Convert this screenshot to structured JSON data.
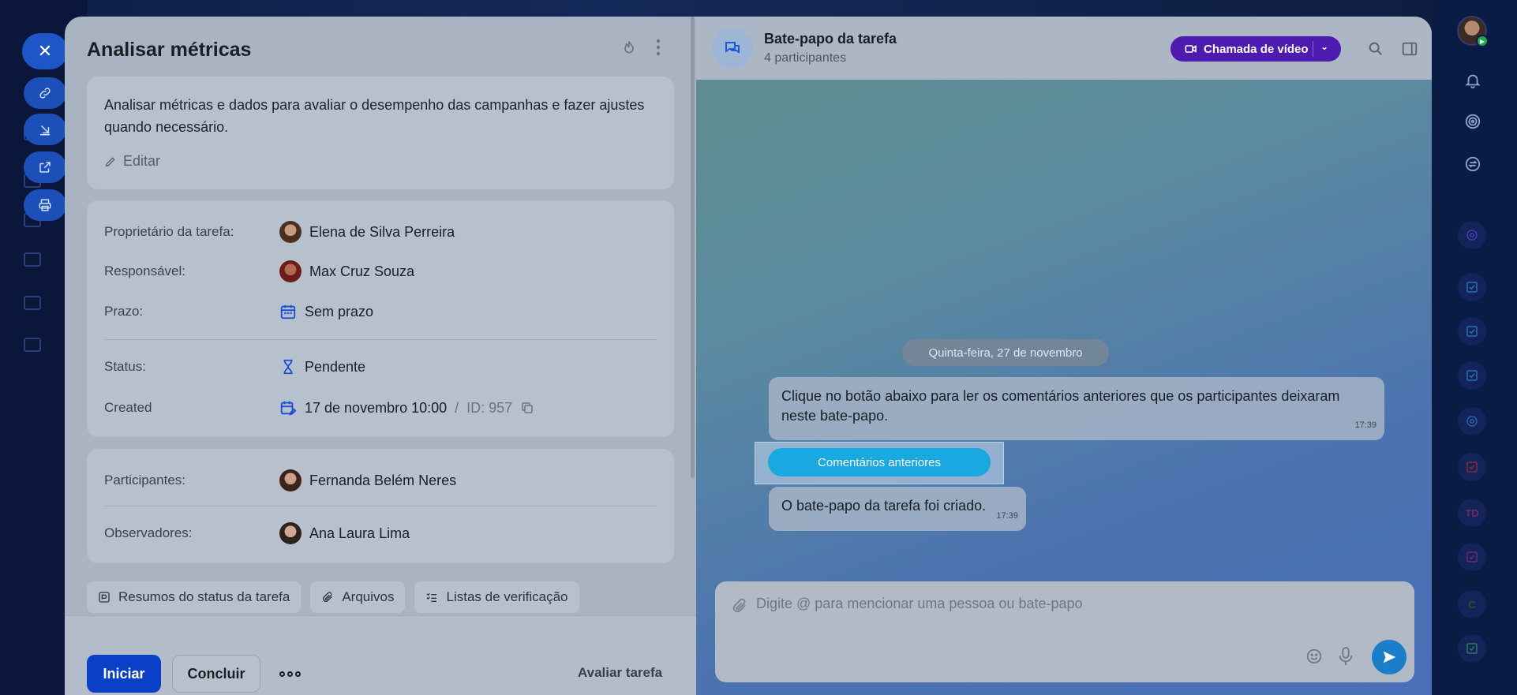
{
  "task": {
    "title": "Analisar métricas",
    "description": "Analisar métricas e dados para avaliar o desempenho das campanhas e fazer ajustes quando necessário.",
    "edit_label": "Editar",
    "owner_label": "Proprietário da tarefa:",
    "owner_value": "Elena de Silva Perreira",
    "assignee_label": "Responsável:",
    "assignee_value": "Max Cruz Souza",
    "deadline_label": "Prazo:",
    "deadline_value": "Sem prazo",
    "status_label": "Status:",
    "status_value": "Pendente",
    "created_label": "Created",
    "created_value": "17 de novembro 10:00",
    "id_sep": "/",
    "id_value": "ID: 957",
    "participants_label": "Participantes:",
    "participants_value": "Fernanda Belém Neres",
    "observers_label": "Observadores:",
    "observers_value": "Ana Laura Lima",
    "tabs": [
      "Resumos do status da tarefa",
      "Arquivos",
      "Listas de verificação"
    ],
    "start_label": "Iniciar",
    "complete_label": "Concluir",
    "rate_label": "Avaliar tarefa"
  },
  "chat": {
    "title": "Bate-papo da tarefa",
    "subtitle": "4 participantes",
    "video_label": "Chamada de vídeo",
    "date_label": "Quinta-feira, 27 de novembro",
    "message1": "Clique no botão abaixo para ler os comentários anteriores que os participantes deixaram neste bate-papo.",
    "message1_time": "17:39",
    "prev_comments_label": "Comentários anteriores",
    "message2": "O bate-papo da tarefa foi criado.",
    "message2_time": "17:39",
    "input_placeholder": "Digite @ para mencionar uma pessoa ou bate-papo"
  },
  "sidebar": {
    "tile_initials": "TD",
    "tile_c": "C"
  },
  "colors": {
    "primary": "#0a40c8",
    "video": "#4d1bb0",
    "prev_button": "#19a8e0",
    "send": "#1a7fc8"
  }
}
